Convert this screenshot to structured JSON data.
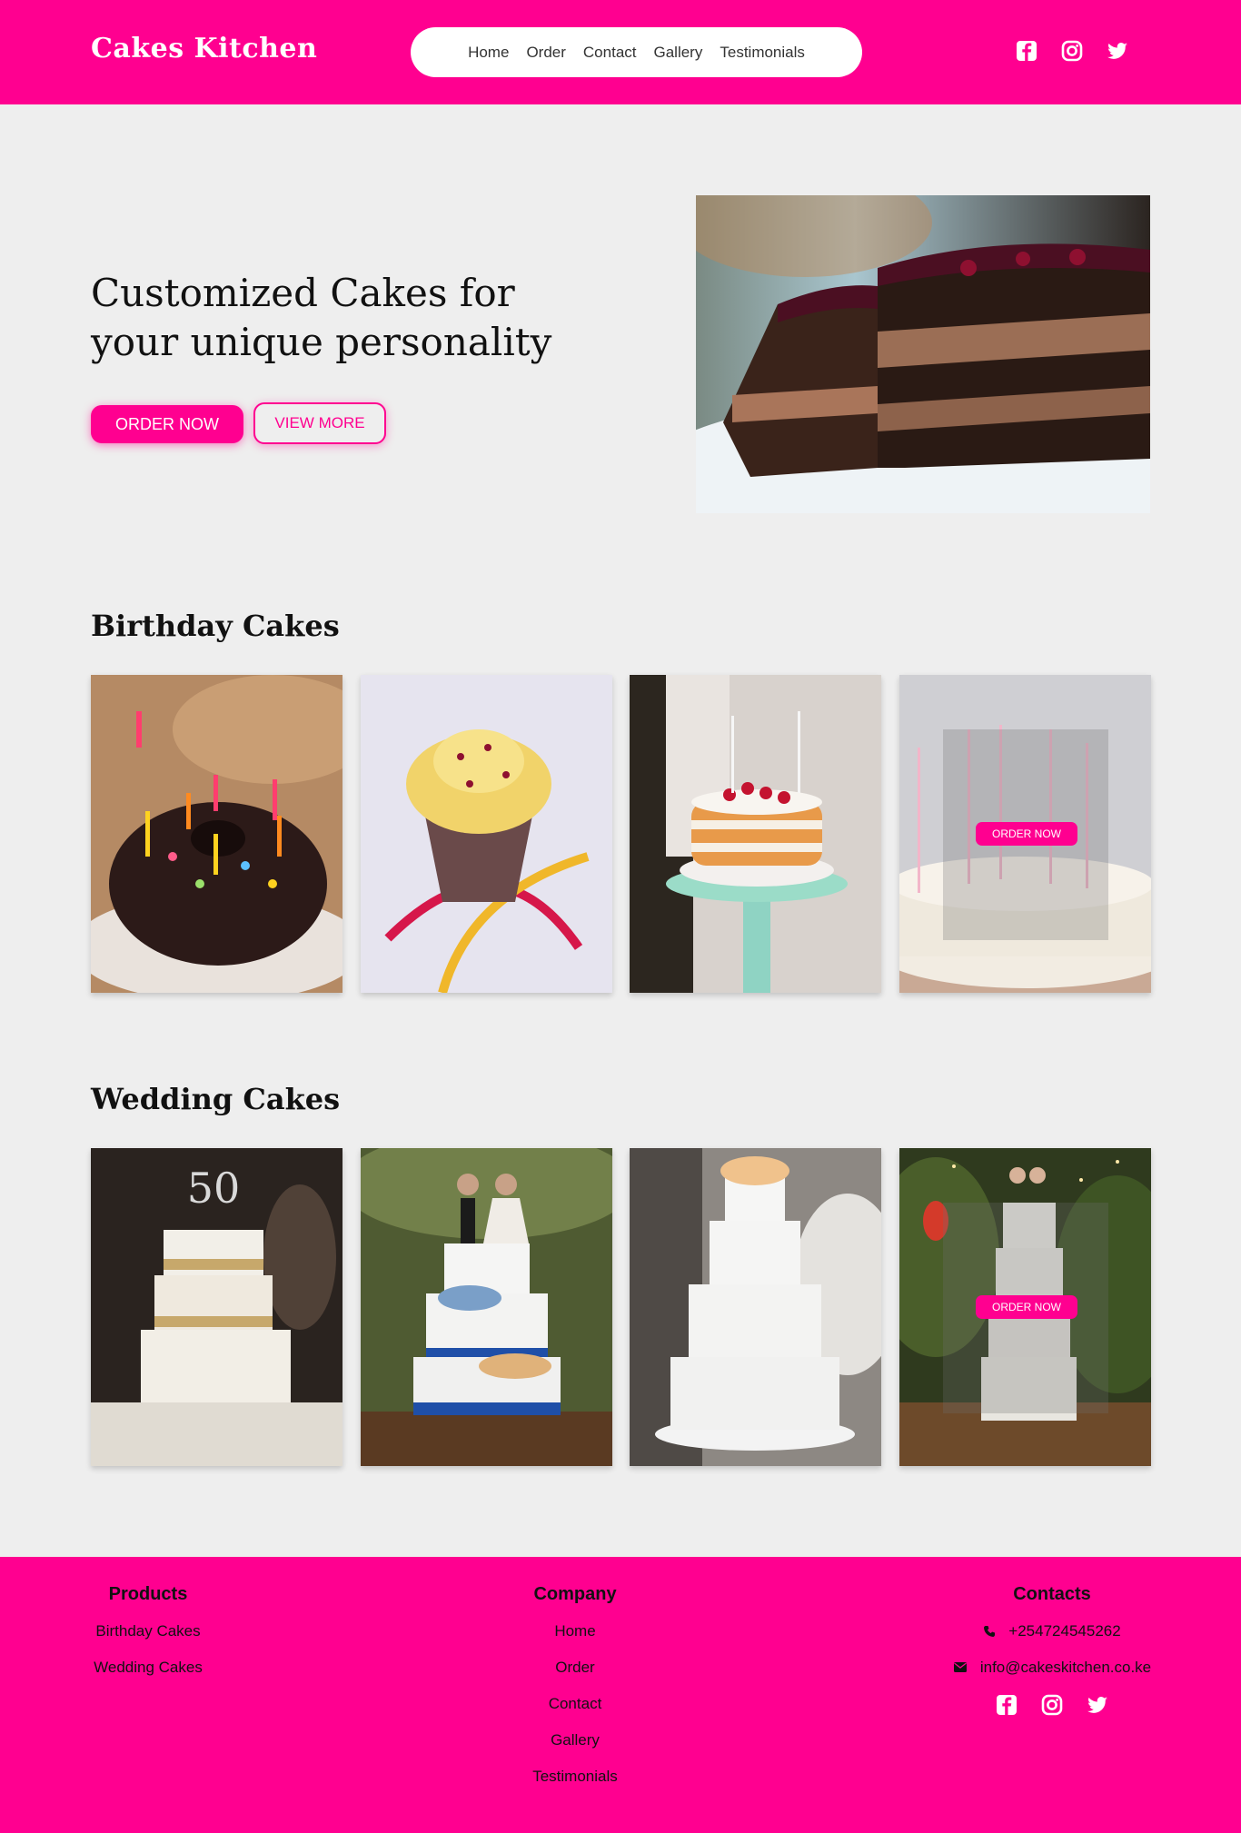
{
  "brand": {
    "name": "Cakes Kitchen",
    "accent": "#ff0090"
  },
  "nav": {
    "items": [
      "Home",
      "Order",
      "Contact",
      "Gallery",
      "Testimonials"
    ]
  },
  "social": [
    "facebook-icon",
    "instagram-icon",
    "twitter-icon"
  ],
  "hero": {
    "title": "Customized Cakes for your unique personality",
    "primary_button": "ORDER NOW",
    "secondary_button": "VIEW MORE"
  },
  "birthday": {
    "title": "Birthday Cakes",
    "cards": [
      {
        "alt": "chocolate bundt cake with candles"
      },
      {
        "alt": "cupcake with ribbons"
      },
      {
        "alt": "raspberry layer cake on stand"
      },
      {
        "alt": "white cake with candles",
        "button": "ORDER NOW"
      }
    ]
  },
  "wedding": {
    "title": "Wedding Cakes",
    "cards": [
      {
        "alt": "50th anniversary tiered cake"
      },
      {
        "alt": "three tier cake with figurines"
      },
      {
        "alt": "white ruffled wedding cake"
      },
      {
        "alt": "tiered cake in garden",
        "button": "ORDER NOW"
      }
    ]
  },
  "footer": {
    "products": {
      "title": "Products",
      "links": [
        "Birthday Cakes",
        "Wedding Cakes"
      ]
    },
    "company": {
      "title": "Company",
      "links": [
        "Home",
        "Order",
        "Contact",
        "Gallery",
        "Testimonials"
      ]
    },
    "contacts": {
      "title": "Contacts",
      "phone": "+254724545262",
      "email": "info@cakeskitchen.co.ke"
    }
  }
}
